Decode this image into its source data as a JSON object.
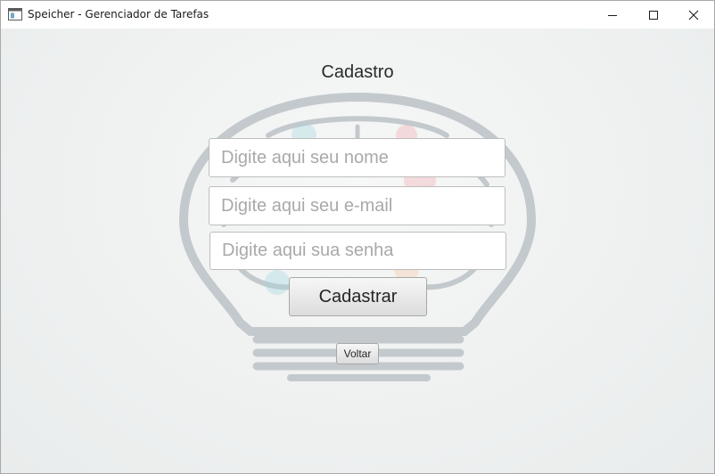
{
  "window": {
    "title": "Speicher - Gerenciador de Tarefas"
  },
  "icons": {
    "app": "app-window-icon",
    "minimize": "minimize-icon",
    "maximize": "maximize-icon",
    "close": "close-icon",
    "background": "lightbulb-brain-illustration"
  },
  "form": {
    "heading": "Cadastro",
    "name_placeholder": "Digite aqui seu nome",
    "email_placeholder": "Digite aqui seu e-mail",
    "password_placeholder": "Digite aqui sua senha",
    "submit_label": "Cadastrar",
    "back_label": "Voltar"
  },
  "colors": {
    "background": "#eff1f1",
    "bulb_outline": "#c3c9cd",
    "bulb_accent_teal": "#9fd3dc",
    "bulb_accent_pink": "#f2a7b0"
  }
}
